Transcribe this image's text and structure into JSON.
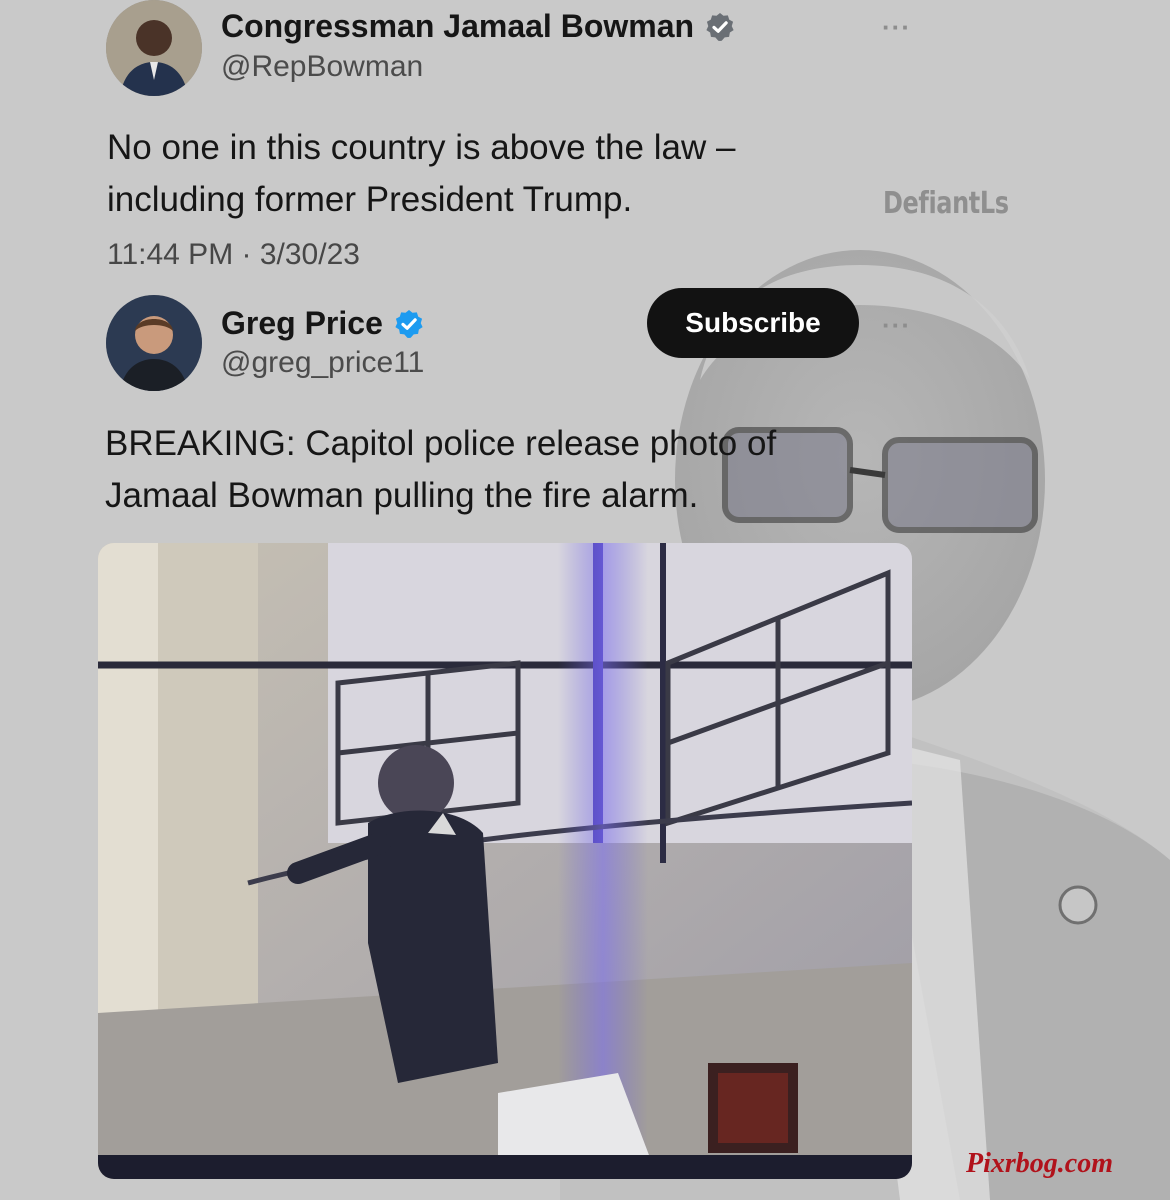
{
  "tweets": [
    {
      "display_name": "Congressman Jamaal Bowman",
      "handle": "@RepBowman",
      "text_line1": "No one in this country is above the law –",
      "text_line2": "including former President Trump.",
      "timestamp": "11:44 PM · 3/30/23",
      "more_icon": "···"
    },
    {
      "display_name": "Greg Price",
      "handle": "@greg_price11",
      "subscribe_label": "Subscribe",
      "text_line1": "BREAKING: Capitol police release photo of",
      "text_line2": "Jamaal Bowman pulling the fire alarm.",
      "more_icon": "···"
    }
  ],
  "watermarks": {
    "top": "DefiantLs",
    "bottom": "Pixrbog.com"
  },
  "colors": {
    "verified": "#1d9bf0",
    "subscribe_bg": "#121212",
    "watermark_red": "#b1121b"
  }
}
